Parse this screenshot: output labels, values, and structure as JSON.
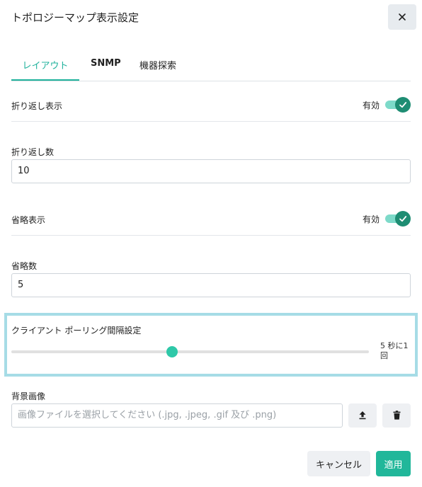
{
  "dialog": {
    "title": "トポロジーマップ表示設定",
    "close_icon": "close-icon"
  },
  "tabs": [
    {
      "label": "レイアウト",
      "active": true
    },
    {
      "label": "SNMP",
      "active": false
    },
    {
      "label": "機器探索",
      "active": false
    }
  ],
  "layout": {
    "wrap_display": {
      "label": "折り返し表示",
      "state_label": "有効",
      "enabled": true
    },
    "wrap_count": {
      "label": "折り返し数",
      "value": "10"
    },
    "omit_display": {
      "label": "省略表示",
      "state_label": "有効",
      "enabled": true
    },
    "omit_count": {
      "label": "省略数",
      "value": "5"
    },
    "polling": {
      "label": "クライアント ポーリング間隔設定",
      "value_text": "5 秒に1回",
      "level": 0.45
    },
    "background": {
      "label": "背景画像",
      "placeholder": "画像ファイルを選択してください (.jpg, .jpeg, .gif 及び .png)",
      "upload_icon": "upload-icon",
      "delete_icon": "trash-icon"
    }
  },
  "footer": {
    "cancel_label": "キャンセル",
    "apply_label": "適用"
  },
  "colors": {
    "accent": "#20b29c",
    "toggle_knob": "#1e8d73",
    "toggle_track": "#7ddac9",
    "highlight_border": "#a6dce6",
    "apply_button": "#21b79a"
  }
}
